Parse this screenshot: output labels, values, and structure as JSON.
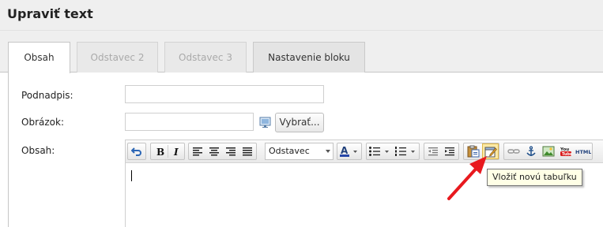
{
  "header": {
    "title": "Upraviť text"
  },
  "tabs": [
    {
      "label": "Obsah",
      "state": "active"
    },
    {
      "label": "Odstavec 2",
      "state": "disabled"
    },
    {
      "label": "Odstavec 3",
      "state": "disabled"
    },
    {
      "label": "Nastavenie bloku",
      "state": "normal"
    }
  ],
  "form": {
    "subtitle_label": "Podnadpis:",
    "subtitle_value": "",
    "image_label": "Obrázok:",
    "image_value": "",
    "choose_button": "Vybrať...",
    "content_label": "Obsah:"
  },
  "editor": {
    "format_select": "Odstavec",
    "toolbar_icons": [
      "undo-icon",
      "bold-icon",
      "italic-icon",
      "align-left-icon",
      "align-center-icon",
      "align-right-icon",
      "align-justify-icon",
      "font-color-icon",
      "bullet-list-icon",
      "numbered-list-icon",
      "outdent-icon",
      "indent-icon",
      "paste-icon",
      "insert-table-icon",
      "link-icon",
      "anchor-icon",
      "image-icon",
      "youtube-icon",
      "html-icon"
    ],
    "body_text": ""
  },
  "tooltip": {
    "text": "Vložiť novú tabuľku"
  },
  "colors": {
    "annotation_arrow": "#e8191e",
    "tooltip_bg": "#ffffe6"
  }
}
